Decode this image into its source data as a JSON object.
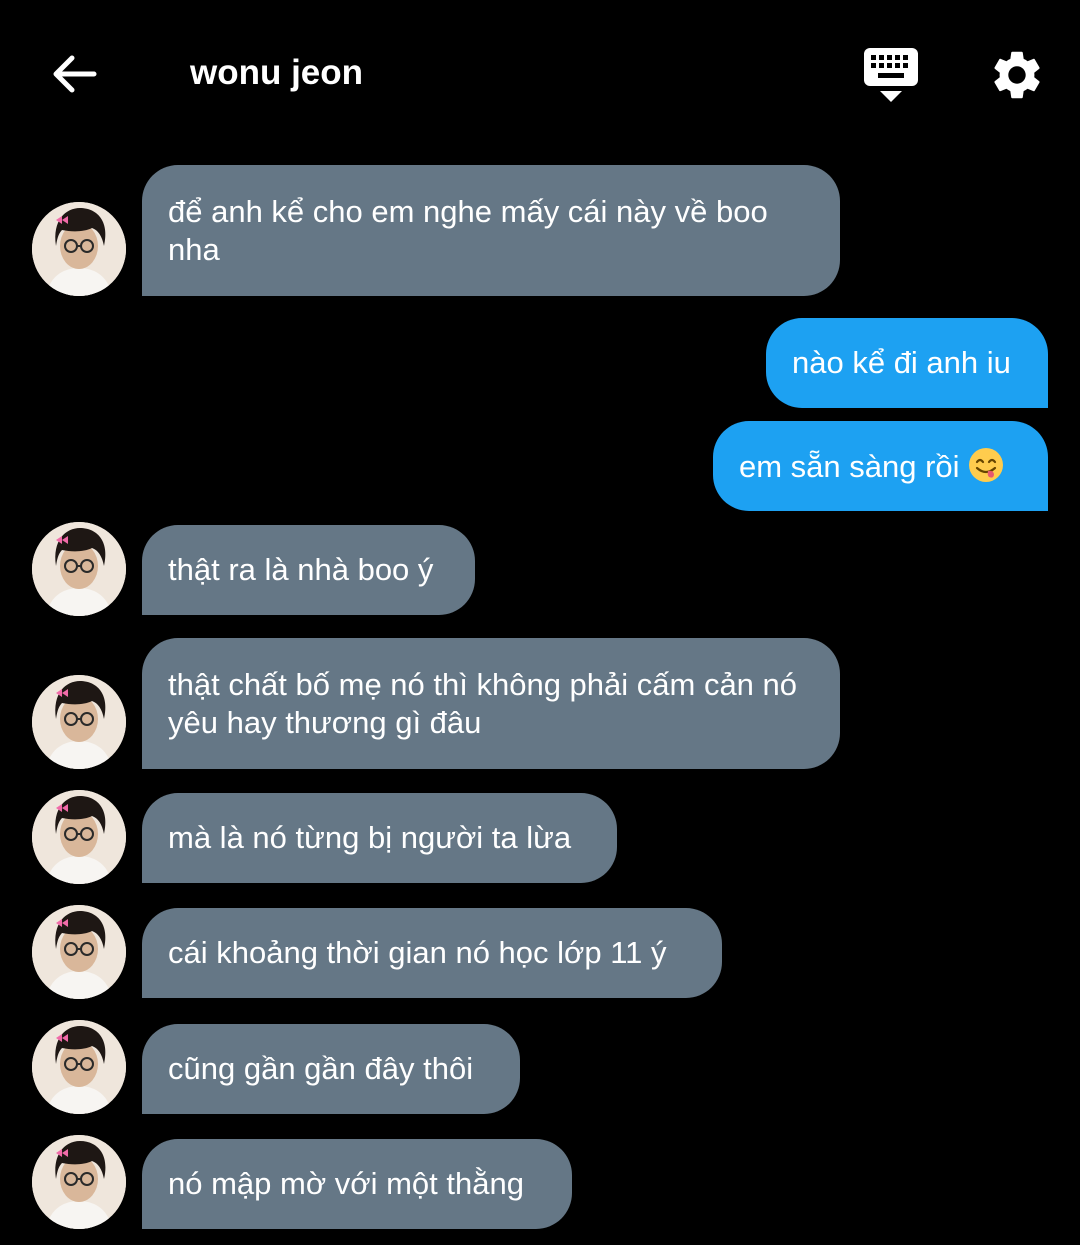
{
  "header": {
    "title": "wonu jeon",
    "back_icon": "arrow-left-icon",
    "keyboard_icon": "keyboard-hide-icon",
    "settings_icon": "gear-icon"
  },
  "colors": {
    "background": "#000000",
    "incoming_bubble": "#657786",
    "outgoing_bubble": "#1da1f2",
    "text": "#ffffff"
  },
  "messages": [
    {
      "direction": "incoming",
      "text": "để anh kể cho em nghe mấy cái này về boo nha"
    },
    {
      "direction": "outgoing",
      "text": "nào kể đi anh iu"
    },
    {
      "direction": "outgoing",
      "text": "em sẵn sàng rồi",
      "emoji": "face-savoring-food-emoji"
    },
    {
      "direction": "incoming",
      "text": "thật ra là nhà boo ý"
    },
    {
      "direction": "incoming",
      "text": "thật chất bố mẹ nó thì không phải cấm cản nó yêu hay thương gì đâu"
    },
    {
      "direction": "incoming",
      "text": "mà là nó từng bị người ta lừa"
    },
    {
      "direction": "incoming",
      "text": "cái khoảng thời gian nó học lớp 11 ý"
    },
    {
      "direction": "incoming",
      "text": "cũng gần gần đây thôi"
    },
    {
      "direction": "incoming",
      "text": "nó mập mờ với một thằng"
    }
  ]
}
